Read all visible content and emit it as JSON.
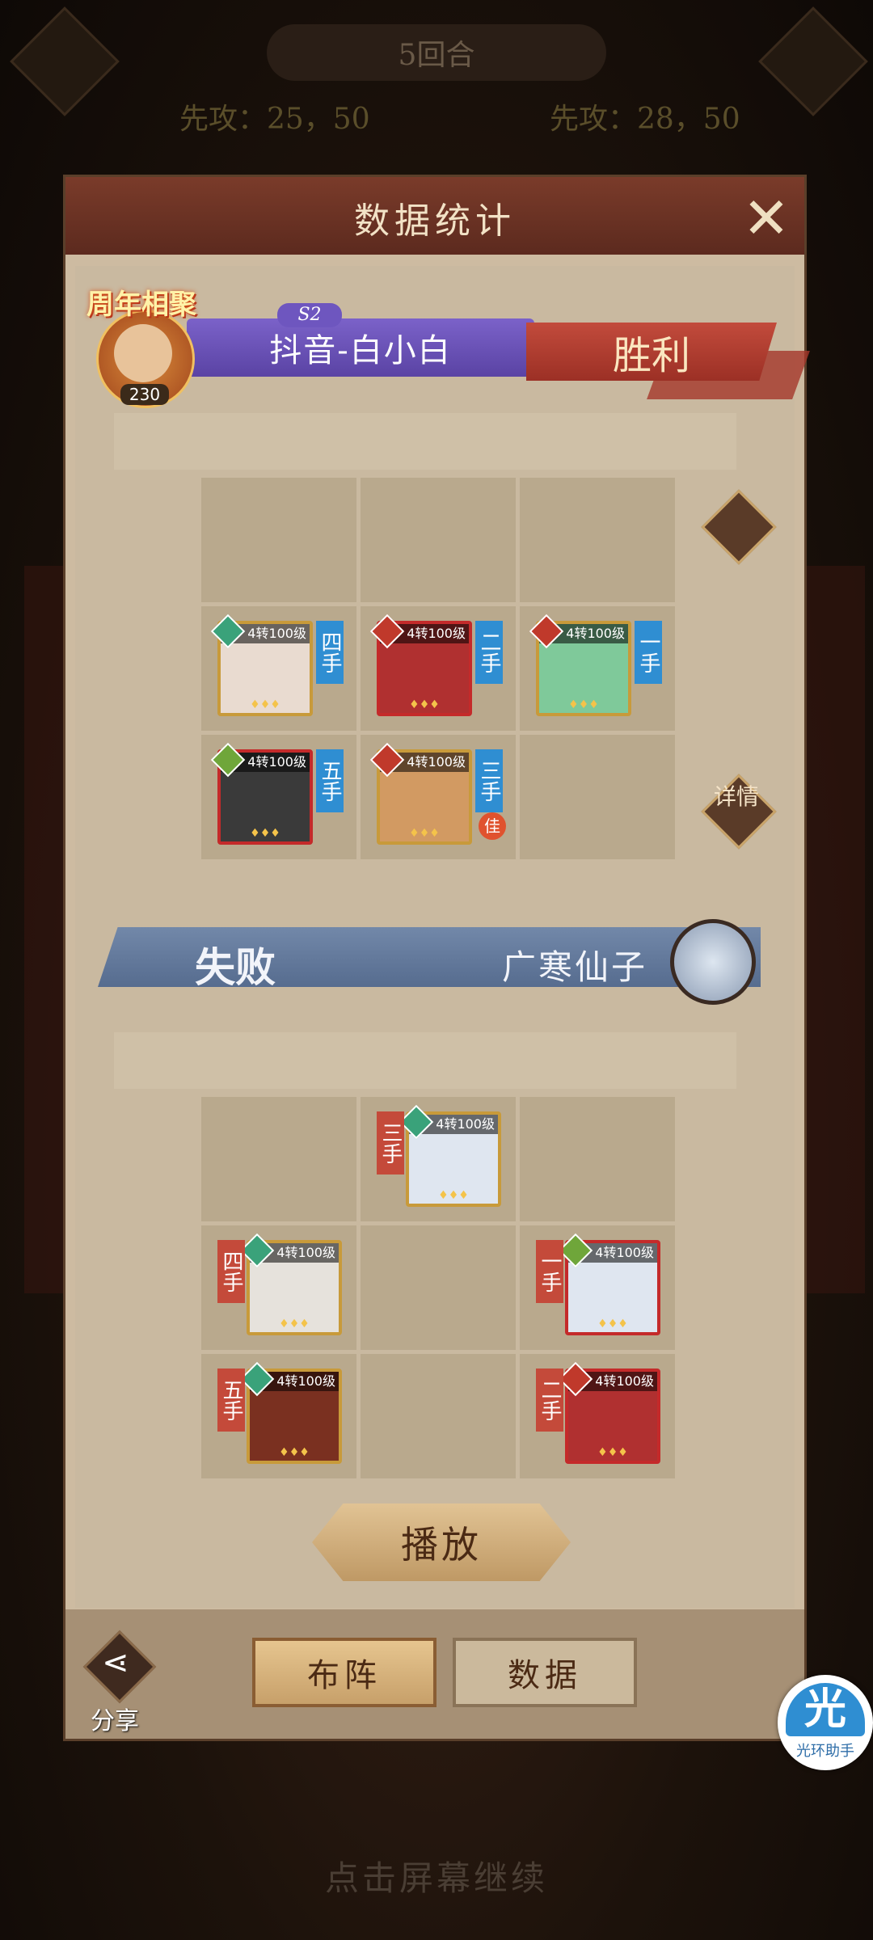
{
  "background": {
    "round_label": "5回合",
    "left_speed": "先攻：25，50",
    "right_speed": "先攻：28，50",
    "continue_hint": "点击屏幕继续"
  },
  "panel": {
    "title": "数据统计",
    "close_icon": "close-icon"
  },
  "player": {
    "event_badge": "周年相聚",
    "season_tag": "S2",
    "name": "抖音-白小白",
    "level": "230",
    "result": "胜利",
    "details_label": "详情",
    "units": [
      {
        "level": "4转100级",
        "order": "四手",
        "frame": "gold",
        "element": "#3aa27a",
        "face": "#e9dbd0"
      },
      {
        "level": "4转100级",
        "order": "二手",
        "frame": "red",
        "element": "#c0392b",
        "face": "#b03030"
      },
      {
        "level": "4转100级",
        "order": "一手",
        "frame": "gold",
        "element": "#c0392b",
        "face": "#7fc99a"
      },
      {
        "level": "4转100级",
        "order": "五手",
        "frame": "red",
        "element": "#6fa63a",
        "face": "#3a3a3a"
      },
      {
        "level": "4转100级",
        "order": "三手",
        "frame": "gold",
        "element": "#c0392b",
        "face": "#d29a62",
        "tag": "佳"
      }
    ]
  },
  "opponent": {
    "name": "广寒仙子",
    "result": "失败",
    "units": [
      {
        "level": "4转100级",
        "order": "三手",
        "frame": "gold",
        "element": "#3aa27a",
        "face": "#dfe6f0"
      },
      {
        "level": "4转100级",
        "order": "四手",
        "frame": "gold",
        "element": "#3aa27a",
        "face": "#e6e2dc"
      },
      {
        "level": "4转100级",
        "order": "一手",
        "frame": "red",
        "element": "#6fa63a",
        "face": "#dfe6f0"
      },
      {
        "level": "4转100级",
        "order": "五手",
        "frame": "gold",
        "element": "#3aa27a",
        "face": "#7a3020"
      },
      {
        "level": "4转100级",
        "order": "二手",
        "frame": "red",
        "element": "#c0392b",
        "face": "#b03030"
      }
    ]
  },
  "actions": {
    "play": "播放",
    "formation": "布阵",
    "data": "数据",
    "share": "分享"
  },
  "assistant": {
    "glyph": "光",
    "label": "光环助手"
  },
  "stars": "♦♦♦"
}
